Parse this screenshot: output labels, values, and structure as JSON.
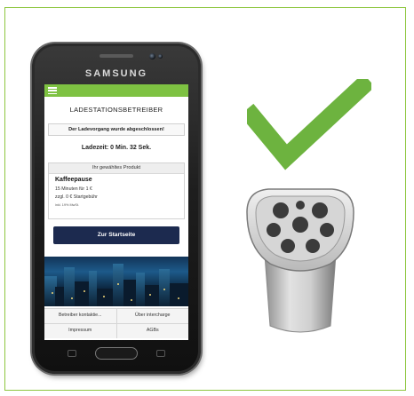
{
  "phone": {
    "brand": "SAMSUNG"
  },
  "app": {
    "title": "LADESTATIONSBETREIBER",
    "notice": "Der Ladevorgang wurde abgeschlossen!",
    "charge_time": "Ladezeit: 0 Min. 32 Sek.",
    "product": {
      "header": "Ihr gewähltes Produkt",
      "name": "Kaffeepause",
      "line1": "15 Minuten für 1 €",
      "line2": "zzgl. 0 € Startgebühr",
      "line3": "inkl. 19% MwSt."
    },
    "start_button": "Zur Startseite",
    "footer_links": [
      {
        "label": "Betreiber kontaktie..."
      },
      {
        "label": "Über intercharge"
      },
      {
        "label": "Impressum"
      },
      {
        "label": "AGBs"
      }
    ]
  },
  "colors": {
    "accent_green": "#7ec242",
    "frame_green": "#8dc63f",
    "button_navy": "#1c2a4f",
    "check_green": "#6db33f"
  },
  "icons": {
    "status": "checkmark-icon",
    "connector": "charging-plug-icon"
  }
}
